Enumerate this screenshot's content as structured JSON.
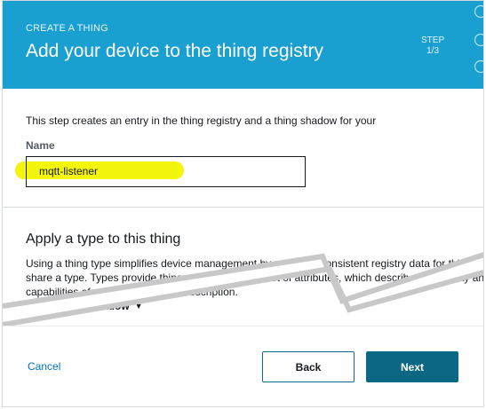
{
  "header": {
    "eyebrow": "CREATE A THING",
    "title": "Add your device to the thing registry",
    "step_label": "STEP",
    "step_value": "1/3"
  },
  "intro": {
    "text": "This step creates an entry in the thing registry and a thing shadow for your"
  },
  "name_field": {
    "label": "Name",
    "value": "mqtt-listener"
  },
  "type_section": {
    "title": "Apply a type to this thing",
    "description": "Using a thing type simplifies device management by providing consistent registry data for things that share a type. Types provide things with a common set of attributes, which describe the identity and capabilities of your device, and a description.",
    "selected_type": "Thing Thing shadow"
  },
  "footer": {
    "cancel_label": "Cancel",
    "back_label": "Back",
    "next_label": "Next"
  },
  "colors": {
    "header_bg": "#1a9fd1",
    "primary_button": "#0b6783",
    "link": "#0073bb",
    "highlight": "#f4f50d"
  }
}
